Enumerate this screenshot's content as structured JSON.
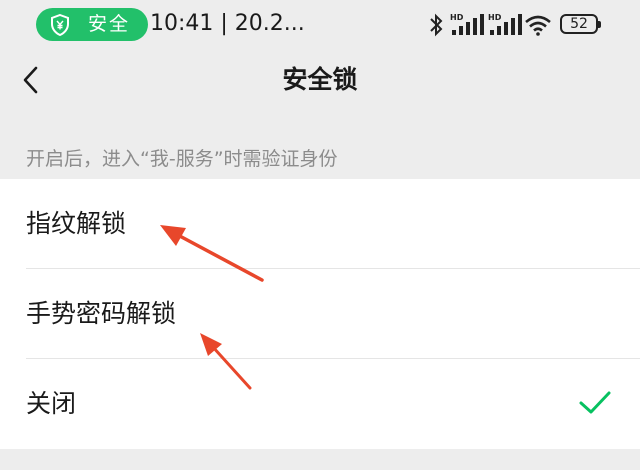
{
  "status_bar": {
    "security_label": "安全",
    "time_text": "10:41 | 20.2...",
    "battery_level": "52",
    "security_color": "#22c06a",
    "icons": [
      "shield-yen-icon",
      "bluetooth-icon",
      "hd-signal-icon",
      "hd-signal-icon",
      "wifi-icon",
      "battery-icon"
    ]
  },
  "nav": {
    "title": "安全锁",
    "back_icon": "chevron-left-icon"
  },
  "description": "开启后，进入“我-服务”时需验证身份",
  "options": [
    {
      "label": "指纹解锁",
      "selected": false
    },
    {
      "label": "手势密码解锁",
      "selected": false
    },
    {
      "label": "关闭",
      "selected": true
    }
  ],
  "colors": {
    "accent_check": "#07c160",
    "annotation_arrow": "#e8472b",
    "background": "#ededed"
  }
}
